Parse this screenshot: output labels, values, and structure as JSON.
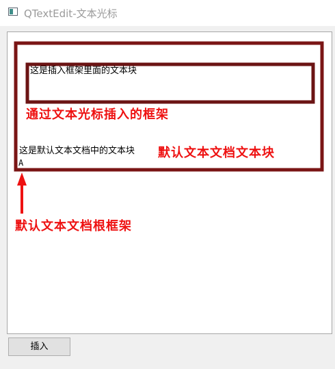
{
  "window": {
    "title": "QTextEdit-文本光标"
  },
  "editor": {
    "inner_frame_text": "这是插入框架里面的文本块",
    "root_block_text": "这是默认文本文档中的文本块",
    "cursor_line_text": "A"
  },
  "annotations": {
    "inner_frame_label": "通过文本光标插入的框架",
    "root_block_label": "默认文本文档文本块",
    "root_frame_label": "默认文本文档根框架",
    "color": "#ee1111",
    "box_color": "#7a1515"
  },
  "toolbar": {
    "insert_label": "插入"
  }
}
